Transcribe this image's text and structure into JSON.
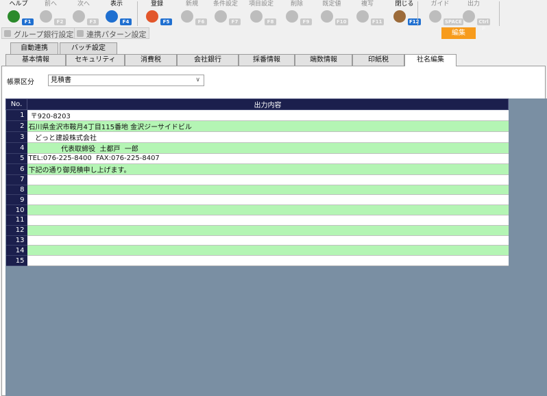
{
  "toolbar": {
    "buttons": [
      {
        "label": "ヘルプ",
        "key": "F1",
        "icon": "help-icon"
      },
      {
        "label": "前へ",
        "key": "F2",
        "icon": "arrow-left-icon"
      },
      {
        "label": "次へ",
        "key": "F3",
        "icon": "arrow-right-icon"
      },
      {
        "label": "表示",
        "key": "F4",
        "icon": "search-icon"
      },
      {
        "label": "登録",
        "key": "F5",
        "icon": "ok-icon"
      },
      {
        "label": "新規",
        "key": "F6",
        "icon": "new-document-icon"
      },
      {
        "label": "条件設定",
        "key": "F7",
        "icon": "filter-icon"
      },
      {
        "label": "項目設定",
        "key": "F8",
        "icon": "item-settings-icon"
      },
      {
        "label": "削除",
        "key": "F9",
        "icon": "trash-icon"
      },
      {
        "label": "既定値",
        "key": "F10",
        "icon": "reset-icon"
      },
      {
        "label": "複写",
        "key": "F11",
        "icon": "copy-icon"
      },
      {
        "label": "閉じる",
        "key": "F12",
        "icon": "close-door-icon"
      },
      {
        "label": "ガイド",
        "key": "SPACE",
        "icon": "guide-bulb-icon"
      },
      {
        "label": "出力",
        "key": "Ctrl P",
        "icon": "print-icon"
      }
    ],
    "sub_buttons": [
      "グループ銀行設定",
      "連携パターン設定"
    ],
    "edit_badge": "編集"
  },
  "tabs_upper": [
    "自動連携",
    "バッチ設定"
  ],
  "tabs_lower": [
    "基本情報",
    "セキュリティ",
    "消費税",
    "会社銀行",
    "採番情報",
    "端数情報",
    "印紙税",
    "社名編集"
  ],
  "active_tab": "社名編集",
  "selector": {
    "label": "帳票区分",
    "value": "見積書"
  },
  "grid": {
    "col_no": "No.",
    "col_content": "出力内容",
    "rows": [
      {
        "no": "1",
        "text": " 〒920-8203"
      },
      {
        "no": "2",
        "text": "石川県金沢市鞍月4丁目115番地 金沢ジーサイドビル"
      },
      {
        "no": "3",
        "text": "   どっと建設株式会社"
      },
      {
        "no": "4",
        "text": "               代表取締役  土都戸  一郎"
      },
      {
        "no": "5",
        "text": "TEL:076-225-8400  FAX:076-225-8407"
      },
      {
        "no": "6",
        "text": "下記の通り御見積申し上げます。"
      },
      {
        "no": "7",
        "text": ""
      },
      {
        "no": "8",
        "text": ""
      },
      {
        "no": "9",
        "text": ""
      },
      {
        "no": "10",
        "text": ""
      },
      {
        "no": "11",
        "text": ""
      },
      {
        "no": "12",
        "text": ""
      },
      {
        "no": "13",
        "text": ""
      },
      {
        "no": "14",
        "text": ""
      },
      {
        "no": "15",
        "text": ""
      }
    ]
  },
  "colors": {
    "accent_blue": "#1f6fd0",
    "header_navy": "#1b1f4d",
    "row_green": "#b4f5b4",
    "edit_orange": "#f79b1c",
    "area_gray_blue": "#7a8fa3"
  }
}
